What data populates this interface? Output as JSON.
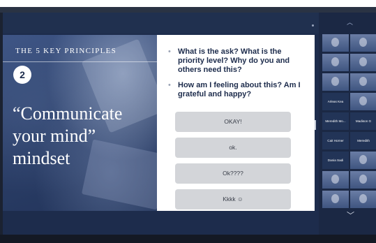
{
  "slide": {
    "kicker": "THE 5 KEY PRINCIPLES",
    "number": "2",
    "title_lines": [
      "“Communicate",
      "your mind”",
      "mindset"
    ]
  },
  "questions": [
    "What is the ask? What is the priority level? Why do you and others need this?",
    "How am I feeling about this? Am I grateful and happy?"
  ],
  "answers": [
    "OKAY!",
    "ok.",
    "Ok????",
    "Kkkk ☺"
  ],
  "participants": [
    "Arleas Kea",
    "Meredith Mo...",
    "Madison G",
    "Cait Horner",
    "Meredith",
    "Dania Sadi"
  ],
  "icons": {
    "bullet": "•",
    "panel_up": "chevron-up-icon",
    "panel_down": "chevron-down-icon",
    "up_glyph": "︿",
    "down_glyph": "﹀"
  },
  "colors": {
    "slide_navy": "#1d2c4c",
    "answer_gray": "#d3d5d9",
    "frame_dark": "#1b2231"
  }
}
